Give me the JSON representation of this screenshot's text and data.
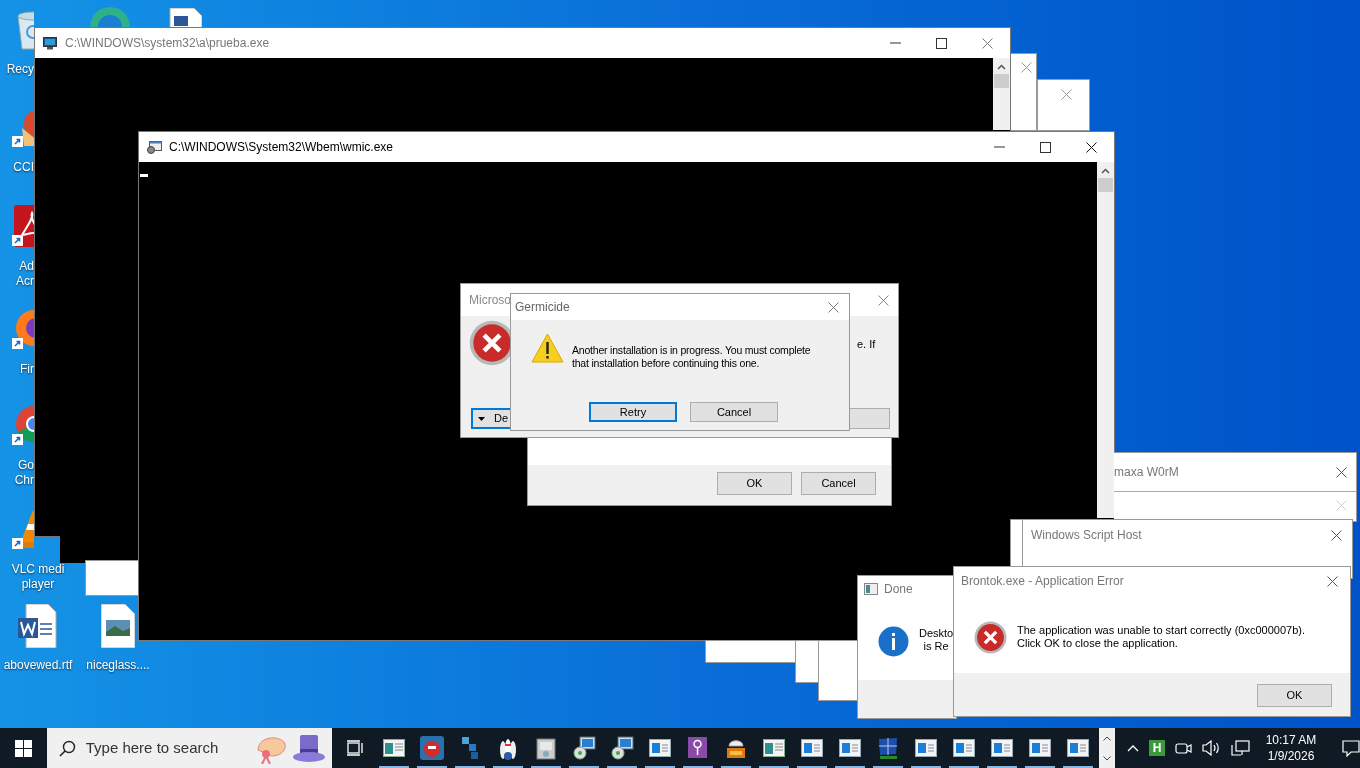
{
  "desktop_icons": [
    {
      "kind": "recycle-bin",
      "shortcut": false,
      "label_lines": [
        "Recy"
      ]
    },
    {
      "kind": "cleaner",
      "shortcut": true,
      "label_lines": [
        "CCI"
      ]
    },
    {
      "kind": "pdf",
      "shortcut": true,
      "label_lines": [
        "Ad",
        "Acr"
      ]
    },
    {
      "kind": "firefox",
      "shortcut": true,
      "label_lines": [
        "Fir"
      ]
    },
    {
      "kind": "chrome",
      "shortcut": true,
      "label_lines": [
        "Go",
        "Chr"
      ]
    },
    {
      "kind": "vlc",
      "shortcut": true,
      "label_lines": [
        "VLC medi",
        "player"
      ]
    },
    {
      "kind": "word-doc",
      "shortcut": false,
      "label_lines": [
        "abovewed.rtf"
      ]
    },
    {
      "kind": "image-file",
      "shortcut": false,
      "label_lines": [
        "niceglass...."
      ]
    }
  ],
  "console_windows": [
    {
      "title": "C:\\WINDOWS\\system32\\a\\prueba.exe",
      "active": false
    },
    {
      "title": "C:\\WINDOWS\\System32\\Wbem\\wmic.exe",
      "active": true
    }
  ],
  "installer_error_dialog": {
    "title": "Microso",
    "message_fragment": "e. If",
    "details_button": "De"
  },
  "confirm_dialog": {
    "buttons": [
      "OK",
      "Cancel"
    ]
  },
  "germicide_dialog": {
    "title": "Germicide",
    "message_lines": [
      "Another installation is in progress. You must complete",
      "that installation before continuing this one."
    ],
    "buttons": [
      {
        "label": "Retry",
        "selected": true
      },
      {
        "label": "Cancel",
        "selected": false
      }
    ]
  },
  "worm_window": {
    "title": "maxa W0rM"
  },
  "script_host_window": {
    "title": "Windows Script Host"
  },
  "done_dialog": {
    "title": "Done",
    "message_lines": [
      "Deskto",
      "is Re"
    ]
  },
  "app_error_dialog": {
    "title": "Brontok.exe - Application Error",
    "message_lines": [
      "The application was unable to start correctly (0xc000007b).",
      "Click OK to close the application."
    ],
    "button": "OK"
  },
  "taskbar": {
    "search_placeholder": "Type here to search",
    "apps": [
      {
        "kind": "window",
        "running": true
      },
      {
        "kind": "bird",
        "running": true
      },
      {
        "kind": "blocks",
        "running": true
      },
      {
        "kind": "pins",
        "running": true
      },
      {
        "kind": "installer",
        "running": true
      },
      {
        "kind": "setup",
        "running": true
      },
      {
        "kind": "setup",
        "running": true
      },
      {
        "kind": "blue-window",
        "running": true
      },
      {
        "kind": "lock",
        "running": true
      },
      {
        "kind": "exe",
        "running": true
      },
      {
        "kind": "window",
        "running": true
      },
      {
        "kind": "blue-window",
        "running": true
      },
      {
        "kind": "blue-window",
        "running": true
      },
      {
        "kind": "network",
        "running": true
      },
      {
        "kind": "blue-window",
        "running": true
      },
      {
        "kind": "blue-window",
        "running": true
      },
      {
        "kind": "blue-window",
        "running": true
      },
      {
        "kind": "blue-window",
        "running": true
      },
      {
        "kind": "blue-window",
        "running": true
      }
    ],
    "tray": {
      "app_letter": "H",
      "time": "10:17 AM",
      "date": "1/9/2026"
    }
  }
}
